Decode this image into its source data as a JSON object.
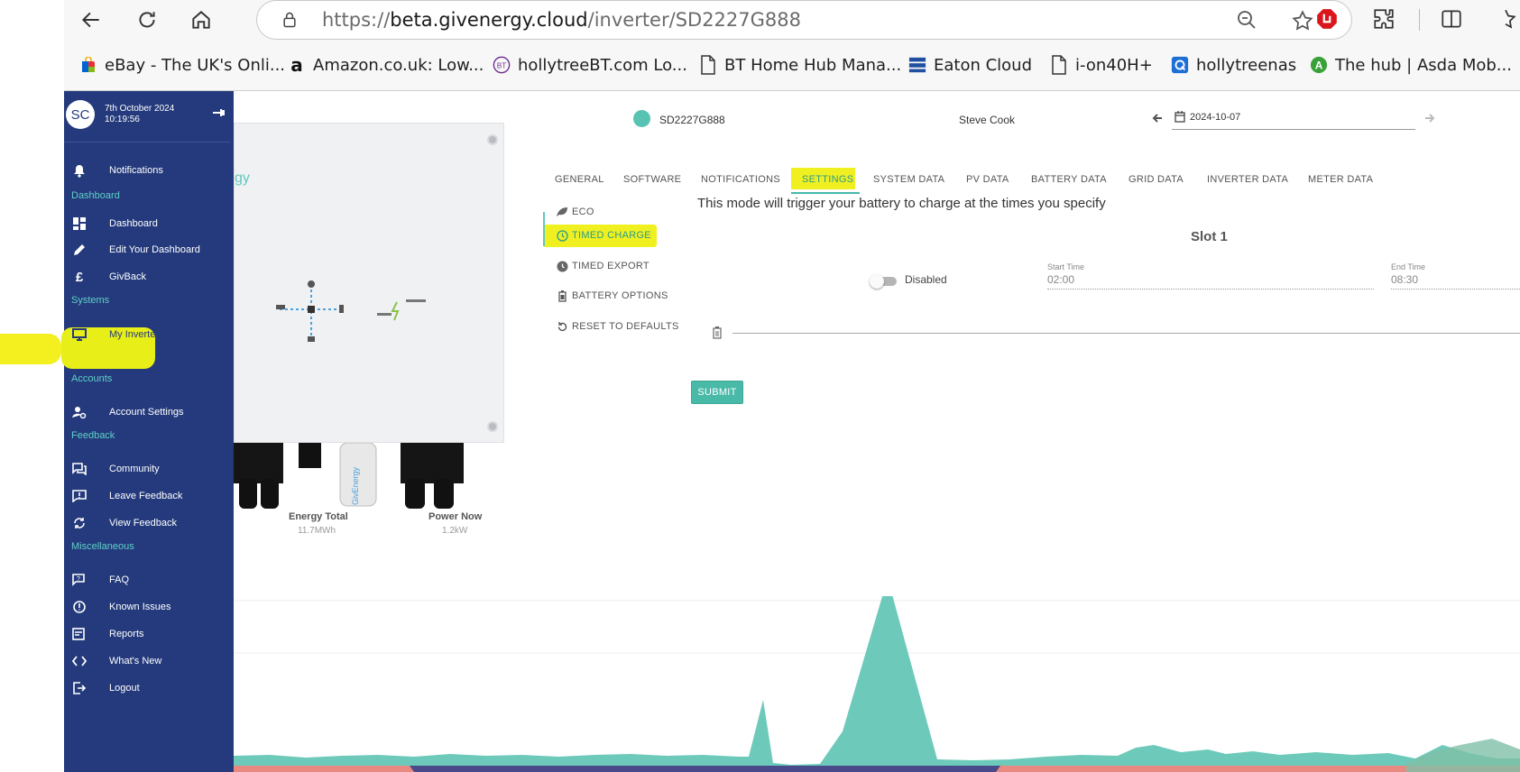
{
  "browser": {
    "url_prefix": "https://",
    "url_domain": "beta.givenergy.cloud",
    "url_path": "/inverter/SD2227G888",
    "bookmarks": [
      {
        "label": "eBay - The UK's Onli...",
        "icon": "ebay-icon"
      },
      {
        "label": "Amazon.co.uk: Low...",
        "icon": "amazon-icon"
      },
      {
        "label": "hollytreeBT.com Lo...",
        "icon": "bt-icon"
      },
      {
        "label": "BT Home Hub Mana...",
        "icon": "page-icon"
      },
      {
        "label": "Eaton Cloud",
        "icon": "eaton-icon"
      },
      {
        "label": "i-on40H+",
        "icon": "page-icon"
      },
      {
        "label": "hollytreenas",
        "icon": "qnap-icon"
      },
      {
        "label": "The hub | Asda Mob...",
        "icon": "asda-icon"
      }
    ],
    "colors": {
      "adblock": "#d9161c",
      "amazon": "#111111"
    }
  },
  "sidebar": {
    "avatar": "SC",
    "date": "7th October 2024",
    "time": "10:19:56",
    "sections": {
      "dashboard": "Dashboard",
      "systems": "Systems",
      "accounts": "Accounts",
      "feedback": "Feedback",
      "misc": "Miscellaneous"
    },
    "items": {
      "notifications": "Notifications",
      "dashboard": "Dashboard",
      "edit_dashboard": "Edit Your Dashboard",
      "givback": "GivBack",
      "my_inverter": "My Inverter",
      "account_settings": "Account Settings",
      "community": "Community",
      "leave_feedback": "Leave Feedback",
      "view_feedback": "View Feedback",
      "faq": "FAQ",
      "known_issues": "Known Issues",
      "reports": "Reports",
      "whats_new": "What's New",
      "logout": "Logout"
    },
    "colors": {
      "bg": "#243a7c",
      "section": "#5fd0c7",
      "highlight": "#e8ee18"
    }
  },
  "main": {
    "device_brand_fragment": "gy",
    "device_logo_text": "GivEnergy",
    "stats": [
      {
        "label": "Energy Total",
        "value": "11.7MWh"
      },
      {
        "label": "Power Now",
        "value": "1.2kW"
      }
    ],
    "serial": "SD2227G888",
    "owner": "Steve Cook",
    "date": "2024-10-07",
    "tabs": [
      "GENERAL",
      "SOFTWARE",
      "NOTIFICATIONS",
      "SETTINGS",
      "SYSTEM DATA",
      "PV DATA",
      "BATTERY DATA",
      "GRID DATA",
      "INVERTER DATA",
      "METER DATA"
    ],
    "active_tab": "SETTINGS",
    "settings_menu": [
      "ECO",
      "TIMED CHARGE",
      "TIMED EXPORT",
      "BATTERY OPTIONS",
      "RESET TO DEFAULTS"
    ],
    "active_setting": "TIMED CHARGE",
    "mode_description": "This mode will trigger your battery to charge at the times you specify",
    "slot": {
      "title": "Slot 1",
      "toggle_label": "Disabled",
      "enabled": false,
      "start_label": "Start Time",
      "start_value": "02:00",
      "end_label": "End Time",
      "end_value": "08:30"
    },
    "submit": "SUBMIT",
    "colors": {
      "accent": "#49b9a8",
      "status": "#59c3b3",
      "highlight": "#f0f020",
      "chart_fill": "#6dcabb",
      "chart_red": "#e88a82",
      "chart_navy": "#4a4a8a"
    }
  }
}
